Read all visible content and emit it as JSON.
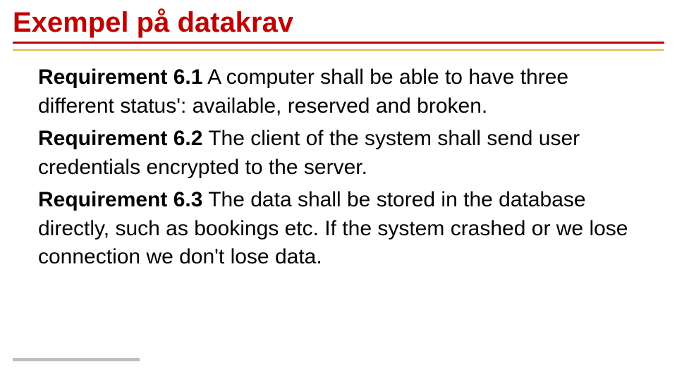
{
  "title": "Exempel på datakrav",
  "requirements": [
    {
      "label": "Requirement 6.1",
      "text": " A computer shall be able to have three different status': available, reserved and broken."
    },
    {
      "label": "Requirement 6.2",
      "text": " The client of the system shall send user credentials encrypted to the server."
    },
    {
      "label": "Requirement 6.3",
      "text": " The data shall be stored in the database directly, such as bookings etc. If the system crashed or we lose connection we don't lose data."
    }
  ]
}
